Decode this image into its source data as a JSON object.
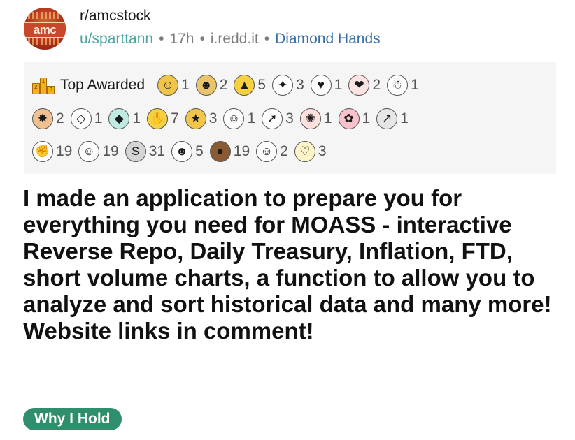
{
  "post": {
    "subreddit": "r/amcstock",
    "username": "u/sparttann",
    "time": "17h",
    "domain": "i.redd.it",
    "user_flair": "Diamond Hands",
    "title": "I made an application to prepare you for everything you need for MOASS - interactive Reverse Repo, Daily Treasury, Inflation, FTD, short volume charts, a function to allow you to analyze and sort historical data and many more! Website links in comment!",
    "post_flair": "Why I Hold"
  },
  "avatar": {
    "logo_text": "amc"
  },
  "awards": {
    "top_label": "Top Awarded",
    "podium": [
      "2",
      "1",
      "3"
    ],
    "row1": [
      {
        "icon": "wholesome-icon",
        "glyph": "☺",
        "count": "1",
        "bg": "#f1c54a"
      },
      {
        "icon": "helpful-icon",
        "glyph": "☻",
        "count": "2",
        "bg": "#e9c46a"
      },
      {
        "icon": "to-the-stars-icon",
        "glyph": "▲",
        "count": "5",
        "bg": "#f5d142"
      },
      {
        "icon": "starstruck-icon",
        "glyph": "✦",
        "count": "3",
        "bg": "#ffffff"
      },
      {
        "icon": "wholesome-snoo-icon",
        "glyph": "♥",
        "count": "1",
        "bg": "#ffffff"
      },
      {
        "icon": "heartwarming-icon",
        "glyph": "❤",
        "count": "2",
        "bg": "#ffe3e3"
      },
      {
        "icon": "chef-snoo-icon",
        "glyph": "☃",
        "count": "1",
        "bg": "#ffffff"
      }
    ],
    "row2": [
      {
        "icon": "fire-icon",
        "glyph": "✸",
        "count": "2",
        "bg": "#f0c090"
      },
      {
        "icon": "gem-hand-icon",
        "glyph": "◇",
        "count": "1",
        "bg": "#ffffff"
      },
      {
        "icon": "diamond-icon",
        "glyph": "◆",
        "count": "1",
        "bg": "#bfe9e1"
      },
      {
        "icon": "handshake-icon",
        "glyph": "✋",
        "count": "7",
        "bg": "#f5d142"
      },
      {
        "icon": "gold-star-icon",
        "glyph": "★",
        "count": "3",
        "bg": "#f1c54a"
      },
      {
        "icon": "snoo-wave-icon",
        "glyph": "☺",
        "count": "1",
        "bg": "#ffffff"
      },
      {
        "icon": "rocket-icon",
        "glyph": "➚",
        "count": "3",
        "bg": "#ffffff"
      },
      {
        "icon": "crab-icon",
        "glyph": "✺",
        "count": "1",
        "bg": "#ffe0dc"
      },
      {
        "icon": "brain-icon",
        "glyph": "✿",
        "count": "1",
        "bg": "#f7c2cc"
      },
      {
        "icon": "stonks-icon",
        "glyph": "↗",
        "count": "1",
        "bg": "#e6e6e6"
      }
    ],
    "row3": [
      {
        "icon": "arm-wrestle-icon",
        "glyph": "✊",
        "count": "19",
        "bg": "#ffffff"
      },
      {
        "icon": "snoo-smile-icon",
        "glyph": "☺",
        "count": "19",
        "bg": "#ffffff"
      },
      {
        "icon": "silver-coin-icon",
        "glyph": "S",
        "count": "31",
        "bg": "#d4d4d4"
      },
      {
        "icon": "bear-snoo-icon",
        "glyph": "☻",
        "count": "5",
        "bg": "#ffffff"
      },
      {
        "icon": "bear-icon",
        "glyph": "●",
        "count": "19",
        "bg": "#8a5a32"
      },
      {
        "icon": "snoo-blush-icon",
        "glyph": "☺",
        "count": "2",
        "bg": "#ffffff"
      },
      {
        "icon": "heart-eyes-icon",
        "glyph": "♡",
        "count": "3",
        "bg": "#fff4c8"
      }
    ]
  },
  "colors": {
    "user": "#4aa5a0",
    "flair_link": "#3a6ea5",
    "pill_bg": "#2f8f6c",
    "awards_bg": "#f5f5f5"
  }
}
